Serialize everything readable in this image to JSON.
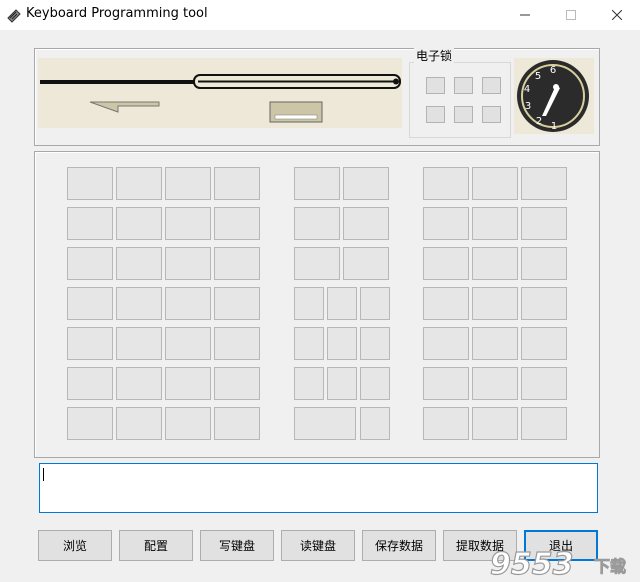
{
  "window": {
    "title": "Keyboard Programming tool"
  },
  "lock": {
    "label": "电子锁"
  },
  "dial": {
    "numbers": [
      "6",
      "5",
      "4",
      "3",
      "2",
      "1"
    ]
  },
  "buttons": {
    "browse": "浏览",
    "config": "配置",
    "write": "写键盘",
    "read": "读键盘",
    "save": "保存数据",
    "extract": "提取数据",
    "exit": "退出"
  },
  "output": {
    "value": ""
  },
  "watermark": {
    "text": "9553",
    "sub": "下载"
  },
  "colors": {
    "focus": "#0078d7",
    "mechanism_bg": "#ede8d7",
    "key_face": "#e6e6e6"
  }
}
